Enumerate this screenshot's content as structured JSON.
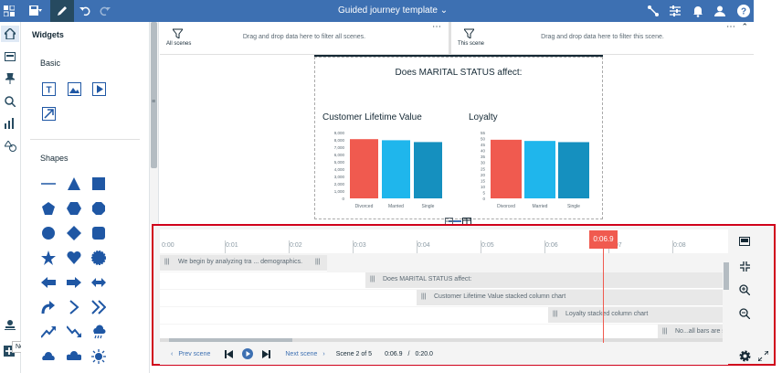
{
  "header": {
    "title": "Guided journey template",
    "icons": [
      "grid-menu-icon",
      "save-icon",
      "pencil-icon",
      "undo-icon",
      "redo-icon",
      "connect-icon",
      "properties-icon",
      "notifications-icon",
      "user-icon",
      "help-icon"
    ]
  },
  "rail": {
    "new_tooltip": "New"
  },
  "widgets": {
    "title": "Widgets",
    "basic_label": "Basic",
    "shapes_label": "Shapes"
  },
  "filters": {
    "all_label": "All scenes",
    "all_hint": "Drag and drop data here to filter all scenes.",
    "this_label": "This scene",
    "this_hint": "Drag and drop data here to filter this scene."
  },
  "scene": {
    "question": "Does MARITAL STATUS affect:",
    "charts": [
      {
        "title": "Customer Lifetime Value",
        "categories": [
          "Divorced",
          "Married",
          "Single"
        ],
        "values": [
          8100,
          7950,
          7700
        ],
        "ylim": [
          0,
          9000
        ],
        "yticks": [
          "9,000",
          "8,000",
          "7,000",
          "6,000",
          "5,000",
          "4,000",
          "3,000",
          "2,000",
          "1,000",
          "0"
        ]
      },
      {
        "title": "Loyalty",
        "categories": [
          "Divorced",
          "Married",
          "Single"
        ],
        "values": [
          49,
          48,
          47
        ],
        "ylim": [
          0,
          55
        ],
        "yticks": [
          "55",
          "50",
          "45",
          "40",
          "35",
          "30",
          "25",
          "20",
          "15",
          "10",
          "5",
          "0"
        ]
      }
    ],
    "colors": [
      "#f05a4f",
      "#1fb6ec",
      "#1590bf"
    ]
  },
  "chart_data": [
    {
      "type": "bar",
      "title": "Customer Lifetime Value",
      "categories": [
        "Divorced",
        "Married",
        "Single"
      ],
      "values": [
        8100,
        7950,
        7700
      ],
      "ylim": [
        0,
        9000
      ]
    },
    {
      "type": "bar",
      "title": "Loyalty",
      "categories": [
        "Divorced",
        "Married",
        "Single"
      ],
      "values": [
        49,
        48,
        47
      ],
      "ylim": [
        0,
        55
      ]
    }
  ],
  "timeline": {
    "ticks": [
      "0:00",
      "0:01",
      "0:02",
      "0:03",
      "0:04",
      "0:05",
      "0:06",
      "0:07",
      "0:08"
    ],
    "current": "0:06.9",
    "tracks": [
      "We begin by analyzing tra ... demographics.",
      "Does MARITAL STATUS affect:",
      "Customer Lifetime Value stacked column chart",
      "Loyalty stacked column chart",
      "No...all bars are s"
    ],
    "prev": "Prev scene",
    "next": "Next scene",
    "scene_status": "Scene 2 of 5",
    "time_current": "0:06.9",
    "time_sep": "/",
    "time_total": "0:20.0"
  }
}
